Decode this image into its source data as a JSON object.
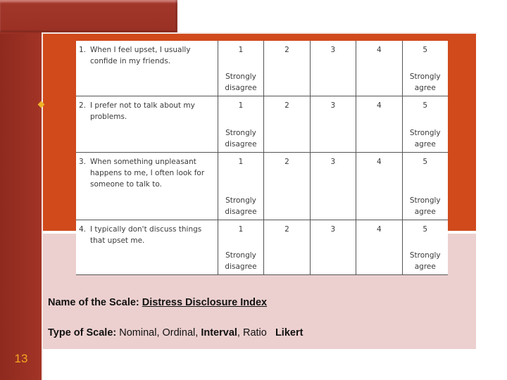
{
  "slide": {
    "page_number": "13",
    "colors": {
      "dark_red": "#9c3124",
      "orange": "#d04a1c",
      "pink": "#ecd0cf",
      "page_number": "#f5a623",
      "bullet": "#f0b429"
    }
  },
  "table": {
    "rows": [
      {
        "number": "1.",
        "statement": "When I feel upset, I usually confide in my friends.",
        "options": [
          "1",
          "2",
          "3",
          "4",
          "5"
        ],
        "low_anchor": "Strongly disagree",
        "high_anchor": "Strongly agree"
      },
      {
        "number": "2.",
        "statement": "I prefer not to talk about my problems.",
        "options": [
          "1",
          "2",
          "3",
          "4",
          "5"
        ],
        "low_anchor": "Strongly disagree",
        "high_anchor": "Strongly agree"
      },
      {
        "number": "3.",
        "statement": "When something unpleasant happens to me, I often look for someone to talk to.",
        "options": [
          "1",
          "2",
          "3",
          "4",
          "5"
        ],
        "low_anchor": "Strongly disagree",
        "high_anchor": "Strongly agree"
      },
      {
        "number": "4.",
        "statement": "I typically don't discuss things that upset me.",
        "options": [
          "1",
          "2",
          "3",
          "4",
          "5"
        ],
        "low_anchor": "Strongly disagree",
        "high_anchor": "Strongly agree"
      }
    ]
  },
  "scale_info": {
    "name_label": "Name of the Scale:",
    "name_value": "Distress Disclosure Index",
    "type_label": "Type of Scale:",
    "type_options": [
      "Nominal",
      "Ordinal",
      "Interval",
      "Ratio"
    ],
    "type_separator": ", ",
    "type_selected": "Interval",
    "type_extra": "Likert"
  }
}
